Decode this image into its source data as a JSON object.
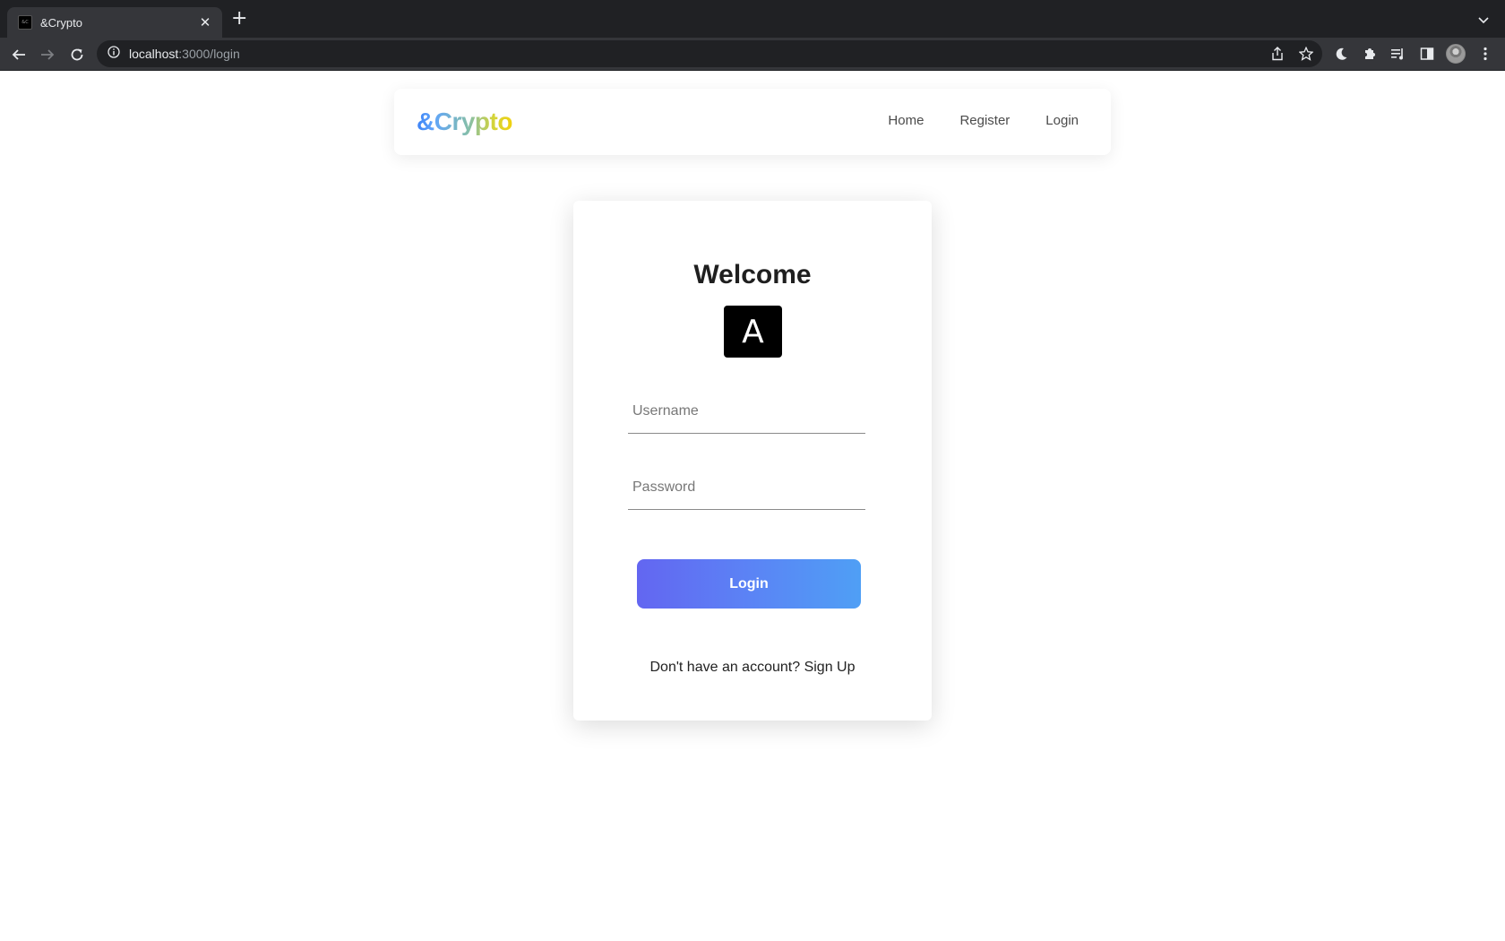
{
  "browser": {
    "tab_title": "&Crypto",
    "url_host": "localhost",
    "url_path": ":3000/login"
  },
  "navbar": {
    "brand": "&Crypto",
    "links": [
      {
        "label": "Home"
      },
      {
        "label": "Register"
      },
      {
        "label": "Login"
      }
    ]
  },
  "login_card": {
    "title": "Welcome",
    "logo_letter": "A",
    "username_placeholder": "Username",
    "password_placeholder": "Password",
    "login_button": "Login",
    "signup_prompt": "Don't have an account?",
    "signup_link": "Sign Up"
  },
  "colors": {
    "button_gradient_start": "#6366f1",
    "button_gradient_end": "#4f9ff5",
    "brand_gradient_start": "#3b82f6",
    "brand_gradient_end": "#f0d10e"
  }
}
